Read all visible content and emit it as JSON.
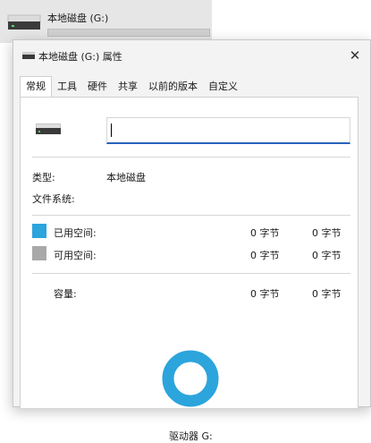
{
  "explorer_item": {
    "label": "本地磁盘 (G:)"
  },
  "dialog": {
    "title": "本地磁盘 (G:) 属性",
    "close_glyph": "✕",
    "tabs": [
      "常规",
      "工具",
      "硬件",
      "共享",
      "以前的版本",
      "自定义"
    ],
    "active_tab": "常规"
  },
  "general": {
    "volume_name_value": "",
    "type_label": "类型:",
    "type_value": "本地磁盘",
    "fs_label": "文件系统:",
    "fs_value": "",
    "used_label": "已用空间:",
    "used_bytes": "0 字节",
    "used_size": "0 字节",
    "free_label": "可用空间:",
    "free_bytes": "0 字节",
    "free_size": "0 字节",
    "capacity_label": "容量:",
    "capacity_bytes": "0 字节",
    "capacity_size": "0 字节",
    "drive_label": "驱动器 G:"
  },
  "colors": {
    "used": "#2ca4dc",
    "free": "#a9a9a9",
    "input_focus": "#2763b8"
  },
  "icons": {
    "drive": "hard-drive-icon",
    "close": "close-icon"
  }
}
